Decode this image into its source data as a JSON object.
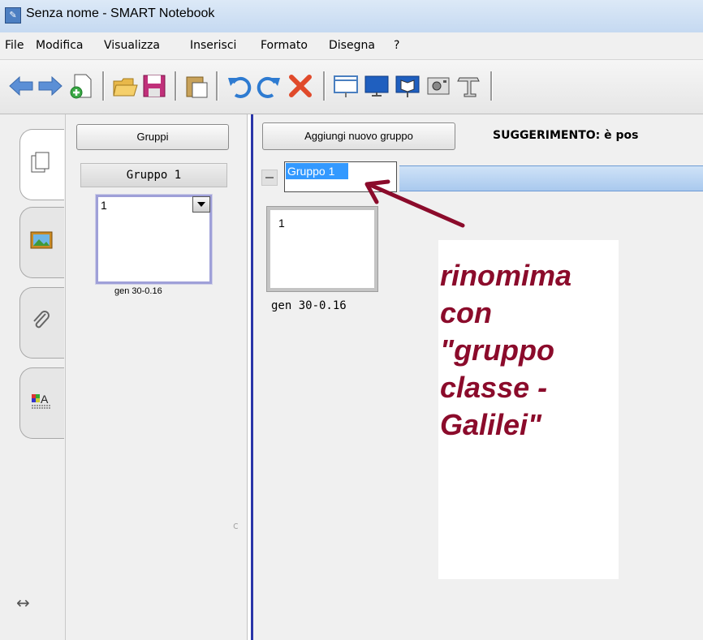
{
  "window": {
    "title": "Senza nome - SMART Notebook"
  },
  "menu": [
    "File",
    "Modifica",
    "Visualizza",
    "Inserisci",
    "Formato",
    "Disegna",
    "?"
  ],
  "toolbar": {
    "icons": [
      "back-arrow-icon",
      "forward-arrow-icon",
      "new-page-icon",
      "open-folder-icon",
      "save-icon",
      "paste-icon",
      "undo-icon",
      "redo-icon",
      "delete-icon",
      "screen-shade-icon",
      "full-screen-icon",
      "dual-page-icon",
      "screen-capture-icon",
      "document-camera-icon"
    ]
  },
  "sidebar_tabs": [
    "page-sorter-icon",
    "gallery-icon",
    "attachments-icon",
    "properties-icon"
  ],
  "sorter": {
    "groups_button": "Gruppi",
    "group_header": "Gruppo 1",
    "thumbnail_number": "1",
    "thumbnail_date": "gen 30-0.16"
  },
  "groups_editor": {
    "add_group_button": "Aggiungi nuovo gruppo",
    "hint": "SUGGERIMENTO: è pos",
    "group_name": "Gruppo 1",
    "page_number": "1",
    "page_date": "gen 30-0.16"
  },
  "annotation": {
    "lines": [
      "rinomima",
      "con",
      "\"gruppo",
      "classe -",
      "Galilei\""
    ],
    "color": "#8b0b2b"
  },
  "colors": {
    "selection": "#3399ff",
    "group_bar": "#a9c9ee",
    "divider": "#2a35a8"
  }
}
